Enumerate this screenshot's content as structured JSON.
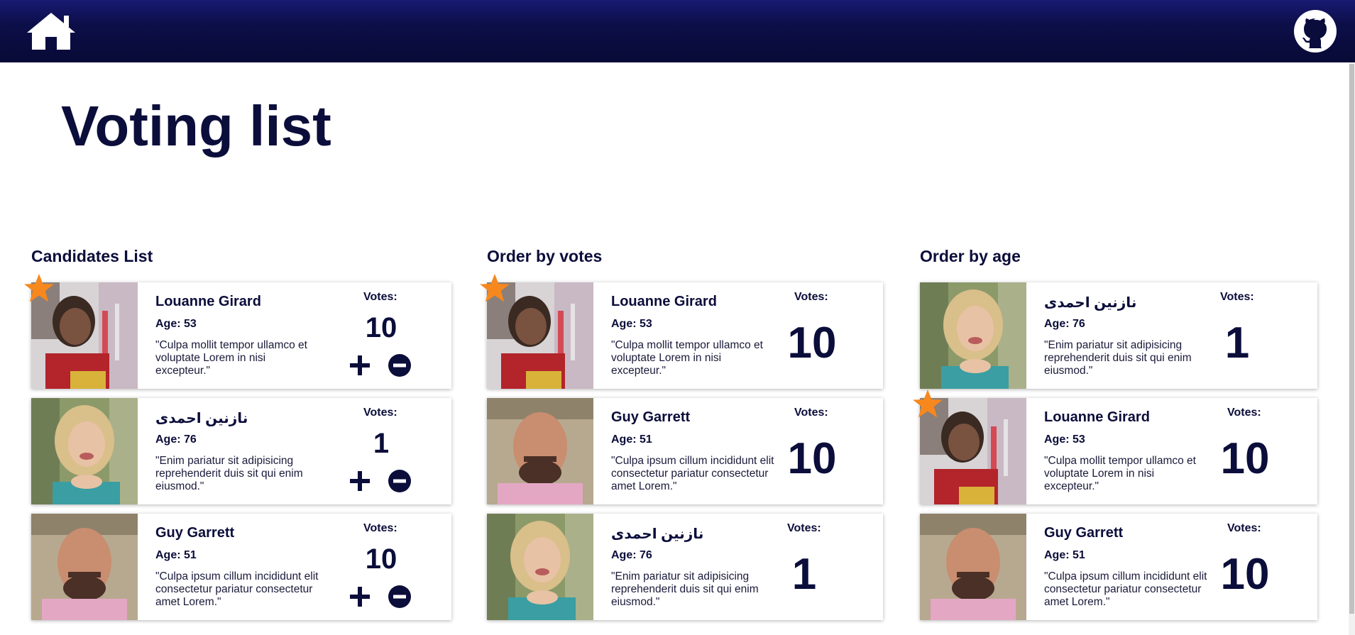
{
  "header": {
    "home_icon": "home-icon",
    "github_icon": "github-icon",
    "color": "#0c0e48"
  },
  "page_title": "Voting list",
  "accent_colors": {
    "star": "#f7881e",
    "text": "#0b0d3a"
  },
  "sections": [
    {
      "title": "Candidates List",
      "cards": [
        {
          "name": "Louanne Girard",
          "age": "Age: 53",
          "quote": "\"Culpa mollit tempor ullamco et voluptate Lorem in nisi excepteur.\"",
          "votes_label": "Votes:",
          "votes": "10",
          "starred": true
        },
        {
          "name": "نازنین احمدی",
          "age": "Age: 76",
          "quote": "\"Enim pariatur sit adipisicing reprehenderit duis sit qui enim eiusmod.\"",
          "votes_label": "Votes:",
          "votes": "1",
          "starred": false
        },
        {
          "name": "Guy Garrett",
          "age": "Age: 51",
          "quote": "\"Culpa ipsum cillum incididunt elit consectetur pariatur consectetur amet Lorem.\"",
          "votes_label": "Votes:",
          "votes": "10",
          "starred": false
        }
      ]
    },
    {
      "title": "Order by votes",
      "cards": [
        {
          "name": "Louanne Girard",
          "age": "Age: 53",
          "quote": "\"Culpa mollit tempor ullamco et voluptate Lorem in nisi excepteur.\"",
          "votes_label": "Votes:",
          "votes": "10",
          "starred": true
        },
        {
          "name": "Guy Garrett",
          "age": "Age: 51",
          "quote": "\"Culpa ipsum cillum incididunt elit consectetur pariatur consectetur amet Lorem.\"",
          "votes_label": "Votes:",
          "votes": "10",
          "starred": false
        },
        {
          "name": "نازنین احمدی",
          "age": "Age: 76",
          "quote": "\"Enim pariatur sit adipisicing reprehenderit duis sit qui enim eiusmod.\"",
          "votes_label": "Votes:",
          "votes": "1",
          "starred": false
        }
      ]
    },
    {
      "title": "Order by age",
      "cards": [
        {
          "name": "نازنین احمدی",
          "age": "Age: 76",
          "quote": "\"Enim pariatur sit adipisicing reprehenderit duis sit qui enim eiusmod.\"",
          "votes_label": "Votes:",
          "votes": "1",
          "starred": false
        },
        {
          "name": "Louanne Girard",
          "age": "Age: 53",
          "quote": "\"Culpa mollit tempor ullamco et voluptate Lorem in nisi excepteur.\"",
          "votes_label": "Votes:",
          "votes": "10",
          "starred": true
        },
        {
          "name": "Guy Garrett",
          "age": "Age: 51",
          "quote": "\"Culpa ipsum cillum incididunt elit consectetur pariatur consectetur amet Lorem.\"",
          "votes_label": "Votes:",
          "votes": "10",
          "starred": false
        }
      ]
    }
  ]
}
